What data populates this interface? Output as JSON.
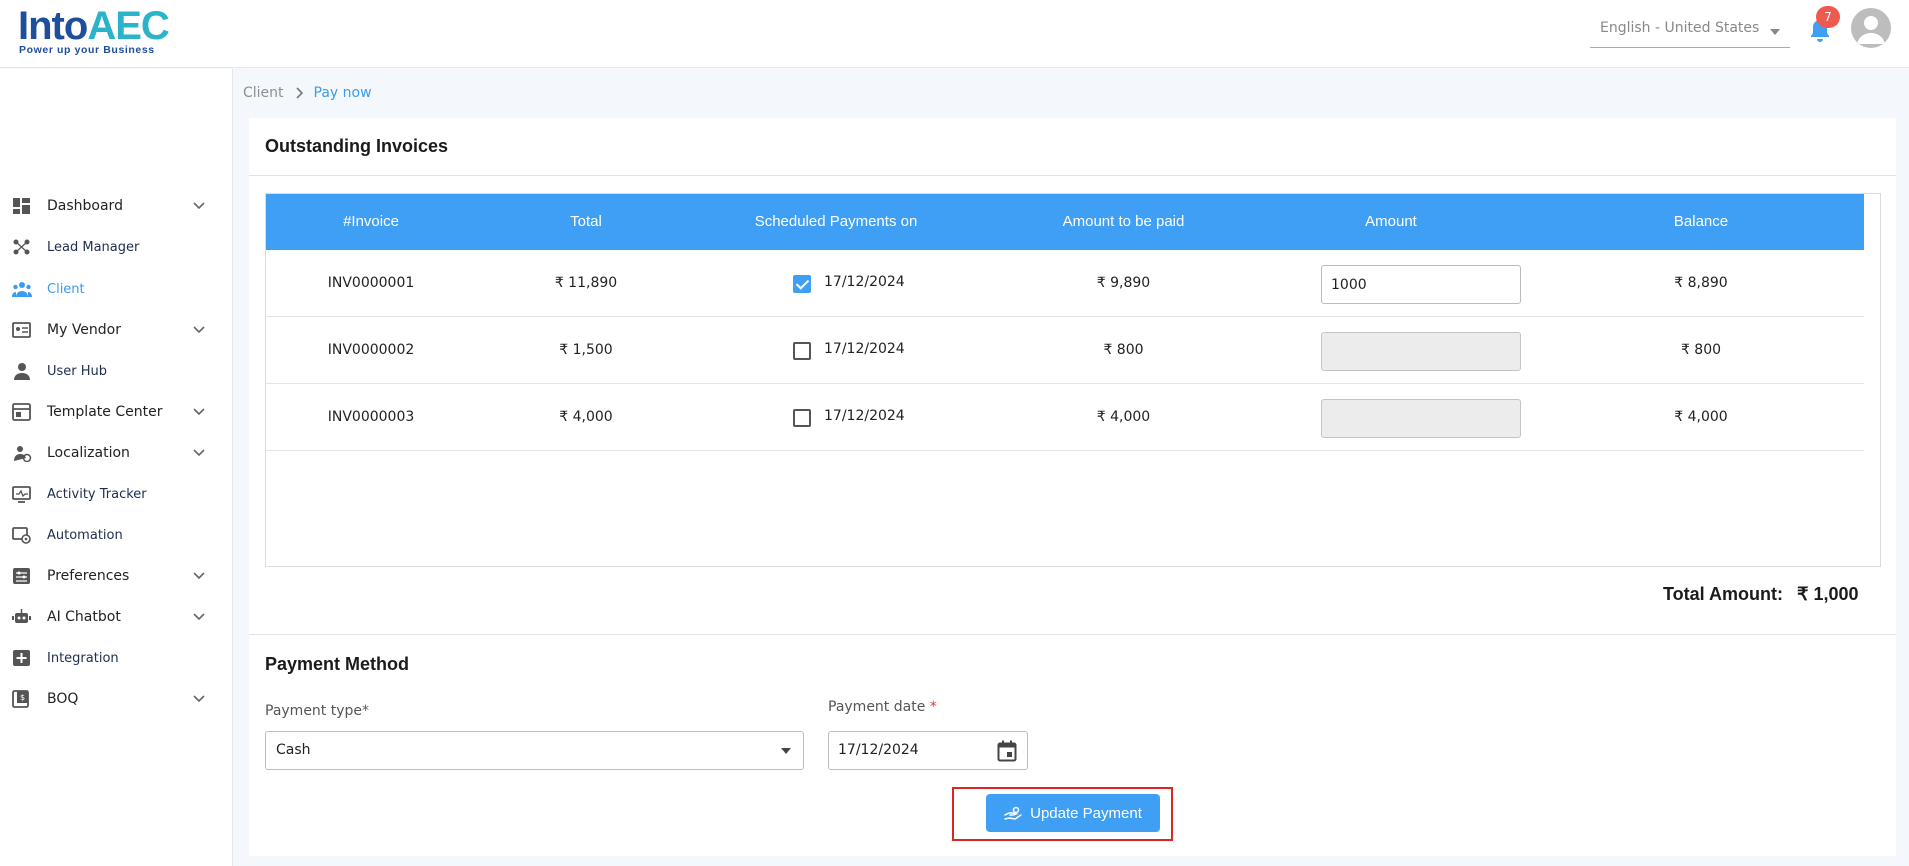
{
  "header": {
    "logo_main": "Into",
    "logo_accent": "AEC",
    "logo_tagline": "Power up your Business",
    "language": "English - United States",
    "notification_count": "7"
  },
  "sidebar": {
    "items": [
      {
        "label": "Dashboard",
        "icon": "dashboard-icon",
        "expandable": true
      },
      {
        "label": "Lead Manager",
        "icon": "lead-manager-icon",
        "expandable": false
      },
      {
        "label": "Client",
        "icon": "client-icon",
        "expandable": false,
        "active": true
      },
      {
        "label": "My Vendor",
        "icon": "vendor-icon",
        "expandable": true
      },
      {
        "label": "User Hub",
        "icon": "user-icon",
        "expandable": false
      },
      {
        "label": "Template Center",
        "icon": "template-icon",
        "expandable": true
      },
      {
        "label": "Localization",
        "icon": "localization-icon",
        "expandable": true
      },
      {
        "label": "Activity Tracker",
        "icon": "activity-icon",
        "expandable": false
      },
      {
        "label": "Automation",
        "icon": "automation-icon",
        "expandable": false
      },
      {
        "label": "Preferences",
        "icon": "preferences-icon",
        "expandable": true
      },
      {
        "label": "AI Chatbot",
        "icon": "chatbot-icon",
        "expandable": true
      },
      {
        "label": "Integration",
        "icon": "integration-icon",
        "expandable": false
      },
      {
        "label": "BOQ",
        "icon": "boq-icon",
        "expandable": true
      }
    ]
  },
  "breadcrumb": {
    "parent": "Client",
    "current": "Pay now"
  },
  "invoices": {
    "title": "Outstanding Invoices",
    "columns": [
      "#Invoice",
      "Total",
      "Scheduled Payments on",
      "Amount to be paid",
      "Amount",
      "Balance"
    ],
    "rows": [
      {
        "invoice": "INV0000001",
        "total": "₹ 11,890",
        "checked": true,
        "date": "17/12/2024",
        "to_pay": "₹ 9,890",
        "amount": "1000",
        "balance": "₹ 8,890"
      },
      {
        "invoice": "INV0000002",
        "total": "₹ 1,500",
        "checked": false,
        "date": "17/12/2024",
        "to_pay": "₹ 800",
        "amount": "",
        "balance": "₹ 800"
      },
      {
        "invoice": "INV0000003",
        "total": "₹ 4,000",
        "checked": false,
        "date": "17/12/2024",
        "to_pay": "₹ 4,000",
        "amount": "",
        "balance": "₹ 4,000"
      }
    ],
    "total_label": "Total Amount:",
    "total_value": "₹ 1,000"
  },
  "payment": {
    "title": "Payment Method",
    "type_label": "Payment type*",
    "type_value": "Cash",
    "date_label": "Payment date",
    "date_required": "*",
    "date_value": "17/12/2024",
    "submit_label": "Update Payment"
  },
  "colors": {
    "accent": "#3f9ff5",
    "highlight": "#e02424"
  }
}
